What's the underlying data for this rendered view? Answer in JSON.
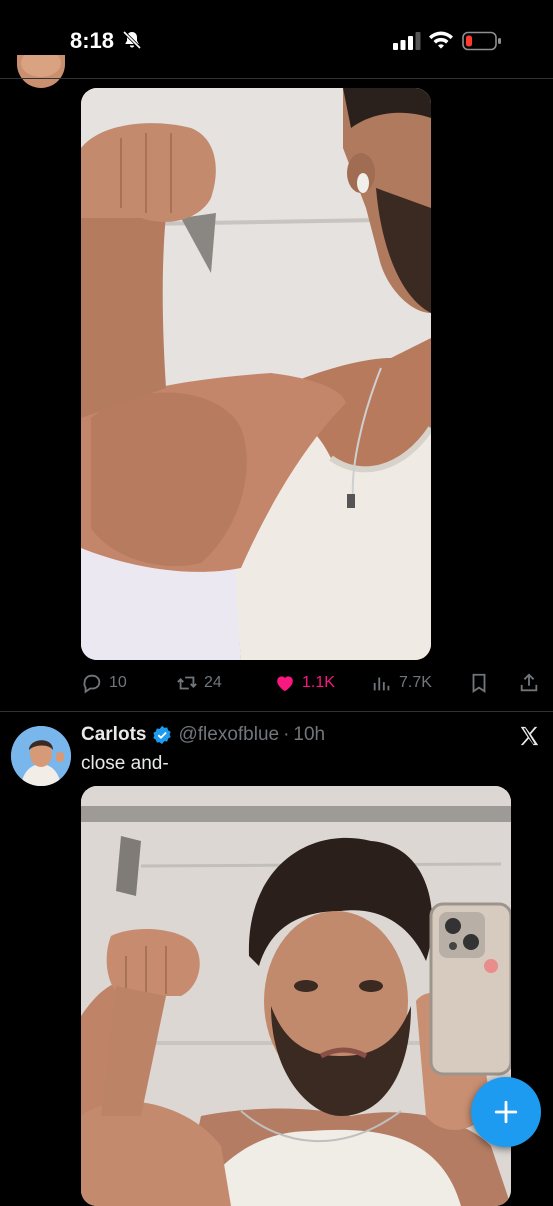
{
  "status_bar": {
    "time": "8:18",
    "icons": [
      "bell-slash-icon",
      "cellular-signal-icon",
      "wifi-icon",
      "battery-low-icon"
    ],
    "battery_color": "#ff3b30"
  },
  "previous_tweet": {
    "photo": "photo-flexing-bicep-tank-top",
    "actions": {
      "replies": "10",
      "reposts": "24",
      "likes": "1.1K",
      "views": "7.7K"
    },
    "liked_color": "#f91880"
  },
  "tweet": {
    "display_name": "Carlots",
    "verified": true,
    "handle": "@flexofblue",
    "separator": "·",
    "time": "10h",
    "text": "close and-",
    "photo": "photo-mirror-selfie-flexing"
  },
  "colors": {
    "accent": "#1d9bf0",
    "muted": "#71767b",
    "text": "#e7e9ea",
    "background": "#000000"
  },
  "fab": {
    "icon": "plus-icon"
  }
}
